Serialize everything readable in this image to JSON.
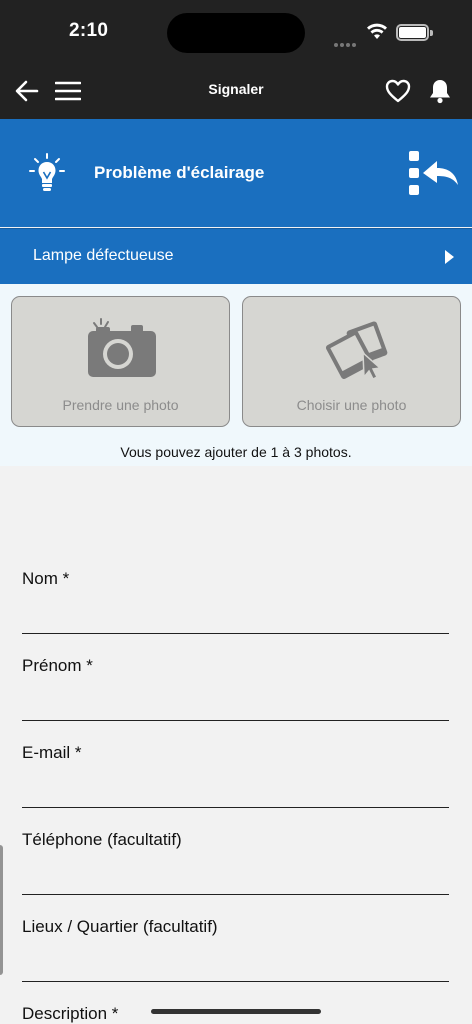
{
  "status_bar": {
    "time": "2:10"
  },
  "navbar": {
    "title": "Signaler",
    "back_icon": "arrow-left-icon",
    "menu_icon": "hamburger-menu-icon",
    "favorite_icon": "heart-icon",
    "notification_icon": "bell-icon"
  },
  "category": {
    "title": "Problème d'éclairage",
    "icon": "lightbulb-icon",
    "change_icon": "list-return-icon"
  },
  "subcategory": {
    "label": "Lampe défectueuse",
    "icon": "chevron-right-icon"
  },
  "photos": {
    "take_label": "Prendre une photo",
    "choose_label": "Choisir une photo",
    "hint": "Vous pouvez ajouter de 1 à 3 photos."
  },
  "form": {
    "fields": [
      {
        "label": "Nom *"
      },
      {
        "label": "Prénom *"
      },
      {
        "label": "E-mail *"
      },
      {
        "label": "Téléphone (facultatif)"
      },
      {
        "label": "Lieux / Quartier (facultatif)"
      },
      {
        "label": "Description *"
      }
    ]
  },
  "colors": {
    "accent": "#1a6fbf",
    "topbar": "#222222",
    "photo_button": "#d6d6d2",
    "background": "#f2f2f2"
  }
}
